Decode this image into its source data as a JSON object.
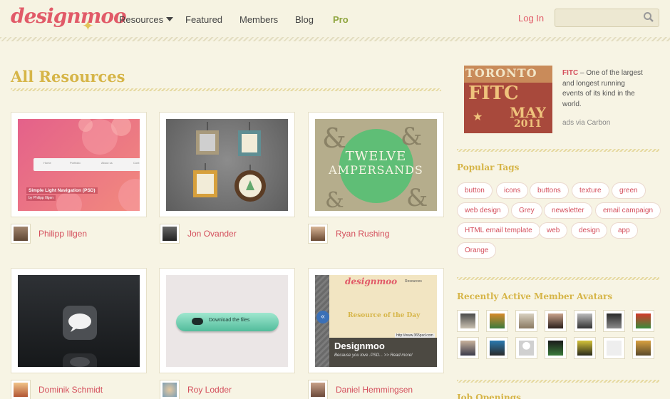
{
  "header": {
    "logo": "designmoo",
    "nav": [
      "Resources",
      "Featured",
      "Members",
      "Blog",
      "Pro"
    ],
    "login": "Log In",
    "search_placeholder": ""
  },
  "main": {
    "title": "All Resources",
    "resources": [
      {
        "author": "Philipp Illgen",
        "thumb_caption": "Simple Light Navigation (PSD)",
        "thumb_sub": "by Philipp Illgen",
        "nav_labels": [
          "Home",
          "Portfolio",
          "About us",
          "Cont"
        ]
      },
      {
        "author": "Jon Ovander"
      },
      {
        "author": "Ryan Rushing",
        "thumb_text": [
          "TWELVE",
          "AMPERSANDS"
        ]
      },
      {
        "author": "Dominik Schmidt"
      },
      {
        "author": "Roy Lodder",
        "thumb_button": "Download the files"
      },
      {
        "author": "Daniel Hemmingsen",
        "thumb_brand": "designmoo",
        "thumb_heading": "Resource of the Day",
        "thumb_title": "Designmoo",
        "thumb_sub": "Because you love .PSD... >> Read more!",
        "thumb_url": "http://www.365psd.com",
        "thumb_menu": "Resources"
      }
    ]
  },
  "sidebar": {
    "ad": {
      "title": "FITC",
      "text": " – One of the largest and longest running events of its kind in the world.",
      "via": "ads via Carbon",
      "img_lines": [
        "TORONTO",
        "FITC",
        "MAY",
        "2011"
      ]
    },
    "tags_title": "Popular Tags",
    "tags": [
      "button",
      "icons",
      "buttons",
      "texture",
      "green",
      "web design",
      "Grey",
      "newsletter",
      "email campaign",
      "HTML email template",
      "web",
      "design",
      "app",
      "Orange"
    ],
    "avatars_title": "Recently Active Member Avatars",
    "jobs_title": "Job Openings"
  },
  "colors": {
    "accent": "#d44f5c",
    "heading": "#d6b548",
    "pro": "#8ea43d",
    "background": "#f7f4e4"
  }
}
